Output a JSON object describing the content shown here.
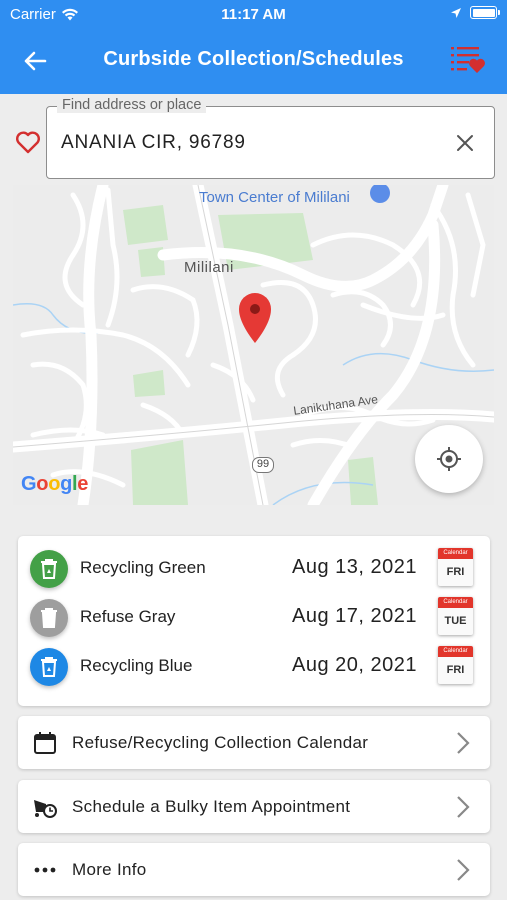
{
  "status_bar": {
    "carrier": "Carrier",
    "time": "11:17 AM"
  },
  "header": {
    "title": "Curbside Collection/Schedules",
    "back_icon": "back-arrow-icon",
    "favorites_icon": "favorites-list-icon"
  },
  "search": {
    "label": "Find address or place",
    "value": "ANANIA CIR, 96789",
    "favorite_icon": "heart-outline-icon",
    "clear_icon": "close-icon"
  },
  "map": {
    "poi_label": "Town Center of Mililani",
    "area_label": "Mililani",
    "street_label": "Lanikuhana Ave",
    "route_label": "99",
    "attribution": "Google",
    "pin_color": "#e53935"
  },
  "schedule": [
    {
      "name": "Recycling Green",
      "date": "Aug 13, 2021",
      "day": "FRI",
      "color": "#43a047",
      "cal_header": "Calendar"
    },
    {
      "name": "Refuse Gray",
      "date": "Aug 17, 2021",
      "day": "TUE",
      "color": "#9e9e9e",
      "cal_header": "Calendar"
    },
    {
      "name": "Recycling Blue",
      "date": "Aug 20, 2021",
      "day": "FRI",
      "color": "#1e88e5",
      "cal_header": "Calendar"
    }
  ],
  "links": [
    {
      "label": "Refuse/Recycling Collection Calendar",
      "icon": "calendar-icon"
    },
    {
      "label": "Schedule a Bulky Item Appointment",
      "icon": "truck-clock-icon"
    },
    {
      "label": "More Info",
      "icon": "more-dots-icon"
    }
  ],
  "colors": {
    "primary": "#2f8ef1",
    "accent_red": "#d32f2f"
  }
}
